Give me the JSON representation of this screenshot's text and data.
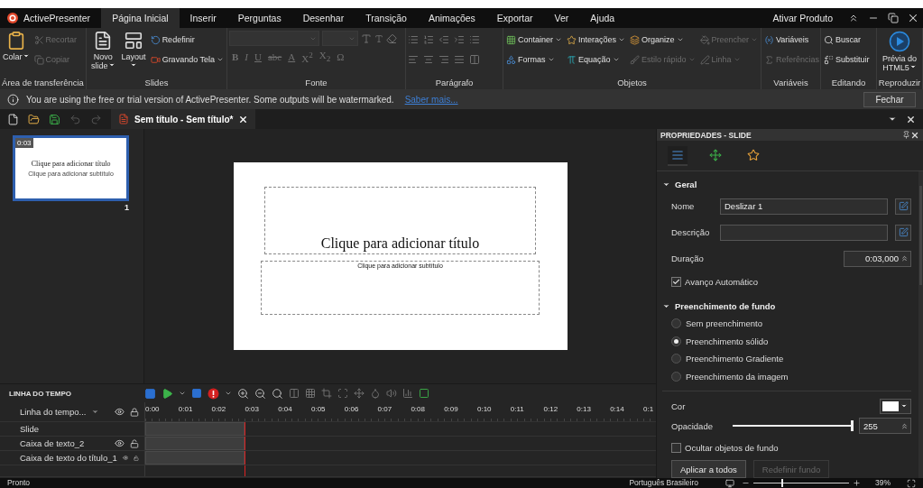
{
  "menu_bar": {
    "app_name": "ActivePresenter",
    "tabs": [
      {
        "label": "Página Inicial",
        "selected": true
      },
      {
        "label": "Inserir",
        "selected": false
      },
      {
        "label": "Perguntas",
        "selected": false
      },
      {
        "label": "Desenhar",
        "selected": false
      },
      {
        "label": "Transição",
        "selected": false
      },
      {
        "label": "Animações",
        "selected": false
      },
      {
        "label": "Exportar",
        "selected": false
      },
      {
        "label": "Ver",
        "selected": false
      },
      {
        "label": "Ajuda",
        "selected": false
      }
    ],
    "activate_link": "Ativar Produto"
  },
  "ribbon": {
    "groups": [
      {
        "kind": "buttons",
        "label": "Área de transferência",
        "items": [
          {
            "kind": "large",
            "label": "Colar",
            "dropdown": true,
            "disabled": false
          },
          {
            "kind": "small",
            "label": "Recortar",
            "dropdown": false,
            "disabled": true
          },
          {
            "kind": "small",
            "label": "Copiar",
            "dropdown": false,
            "disabled": true
          }
        ]
      },
      {
        "kind": "buttons",
        "label": "Slides",
        "items": [
          {
            "kind": "large",
            "label": "Novo slide",
            "dropdown": true,
            "disabled": false
          },
          {
            "kind": "large",
            "label": "Layout",
            "dropdown": true,
            "disabled": false
          },
          {
            "kind": "small",
            "label": "Redefinir",
            "dropdown": false,
            "disabled": false
          },
          {
            "kind": "small",
            "label": "Gravando Tela",
            "dropdown": true,
            "disabled": false
          }
        ]
      },
      {
        "kind": "font",
        "label": "Fonte",
        "buttons": [
          "B",
          "I",
          "U",
          "abc",
          "A",
          "X$^{2}$",
          "X$_{2}$",
          "Ω"
        ]
      },
      {
        "kind": "paragraph",
        "label": "Parágrafo"
      },
      {
        "kind": "buttons",
        "label": "Objetos",
        "items": [
          {
            "kind": "small",
            "label": "Container",
            "dropdown": true,
            "disabled": false
          },
          {
            "kind": "small",
            "label": "Interações",
            "dropdown": true,
            "disabled": false
          },
          {
            "kind": "small",
            "label": "Organize",
            "dropdown": true,
            "disabled": false
          },
          {
            "kind": "small",
            "label": "Preencher",
            "dropdown": true,
            "disabled": true
          },
          {
            "kind": "small",
            "label": "Formas",
            "dropdown": true,
            "disabled": false
          },
          {
            "kind": "small",
            "label": "Equação",
            "dropdown": true,
            "disabled": false
          },
          {
            "kind": "small",
            "label": "Estilo rápido",
            "dropdown": true,
            "disabled": true
          },
          {
            "kind": "small",
            "label": "Linha",
            "dropdown": true,
            "disabled": true
          }
        ]
      },
      {
        "kind": "buttons",
        "label": "Variáveis",
        "items": [
          {
            "kind": "small",
            "label": "Variáveis",
            "dropdown": false,
            "disabled": false
          },
          {
            "kind": "small",
            "label": "Referências",
            "dropdown": false,
            "disabled": true
          }
        ]
      },
      {
        "kind": "buttons",
        "label": "Editando",
        "items": [
          {
            "kind": "small",
            "label": "Buscar",
            "dropdown": false,
            "disabled": false
          },
          {
            "kind": "small",
            "label": "Substituir",
            "dropdown": false,
            "disabled": false
          }
        ]
      },
      {
        "kind": "buttons",
        "label": "Reproduzir",
        "items": [
          {
            "kind": "large",
            "label": "Prévia do HTML5",
            "dropdown": true,
            "disabled": false
          }
        ]
      }
    ]
  },
  "notice": {
    "text": "You are using the free or trial version of ActivePresenter. Some outputs will be watermarked.",
    "link": "Saber mais...",
    "button": "Fechar"
  },
  "document_tabs": [
    {
      "label": "Sem título - Sem título*",
      "selected": true
    }
  ],
  "slides": [
    {
      "number": "1",
      "duration": "0:03",
      "title": "Clique para adicionar título",
      "subtitle": "Clique para adicionar subtítulo",
      "selected": true
    }
  ],
  "canvas": {
    "title_placeholder": "Clique para adicionar título",
    "subtitle_placeholder": "Clique para adicionar subtítulo"
  },
  "timeline": {
    "title": "LINHA DO TEMPO",
    "selector": "Linha do tempo...",
    "ticks": [
      "0:00",
      "0:01",
      "0:02",
      "0:03",
      "0:04",
      "0:05",
      "0:06",
      "0:07",
      "0:08",
      "0:09",
      "0:10",
      "0:11",
      "0:12",
      "0:13",
      "0:14",
      "0:1"
    ],
    "tracks": [
      {
        "name": "Slide",
        "kind": "slide"
      },
      {
        "name": "Caixa de texto_2",
        "kind": "object"
      },
      {
        "name": "Caixa de texto do título_1",
        "kind": "object"
      }
    ]
  },
  "properties": {
    "title": "PROPRIEDADES - SLIDE",
    "tabs": [
      {
        "selected": true
      },
      {
        "selected": false
      },
      {
        "selected": false
      }
    ],
    "general": {
      "title": "Geral",
      "expanded": true,
      "name_label": "Nome",
      "name_value": "Deslizar 1",
      "description_label": "Descrição",
      "duration_label": "Duração",
      "duration_value": "0:03,000",
      "auto_advance": {
        "label": "Avanço Automático",
        "checked": true
      }
    },
    "background": {
      "title": "Preenchimento de fundo",
      "expanded": true,
      "options": [
        {
          "label": "Sem preenchimento",
          "selected": false
        },
        {
          "label": "Preenchimento sólido",
          "selected": true
        },
        {
          "label": "Preenchimento Gradiente",
          "selected": false
        },
        {
          "label": "Preenchimento da imagem",
          "selected": false
        }
      ],
      "color_label": "Cor",
      "opacity_label": "Opacidade",
      "opacity": {
        "level": 1,
        "value": "255"
      },
      "hide_objects": {
        "label": "Ocultar objetos de fundo",
        "checked": false
      },
      "buttons": [
        {
          "label": "Aplicar a todos",
          "disabled": false
        },
        {
          "label": "Redefinir fundo",
          "disabled": true
        }
      ]
    }
  },
  "status_bar": {
    "text": "Pronto",
    "language": "Português Brasileiro",
    "zoom": {
      "level": 0.3,
      "value": "39%"
    }
  }
}
